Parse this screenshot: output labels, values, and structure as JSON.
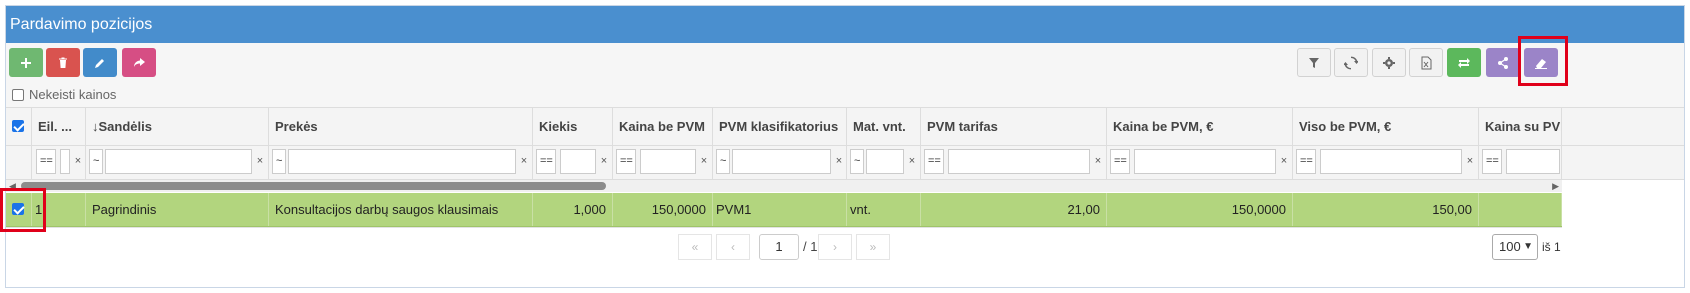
{
  "panel": {
    "title": "Pardavimo pozicijos"
  },
  "toolbar": {
    "left_buttons": [
      {
        "icon": "plus-icon",
        "color": "#6fb871"
      },
      {
        "icon": "trash-icon",
        "color": "#d9534f"
      },
      {
        "icon": "pencil-icon",
        "color": "#428bca"
      },
      {
        "icon": "share-arrow-icon",
        "color": "#d64e84"
      }
    ],
    "right_buttons": [
      {
        "icon": "filter-icon"
      },
      {
        "icon": "refresh-icon"
      },
      {
        "icon": "gear-icon"
      },
      {
        "icon": "excel-icon"
      },
      {
        "icon": "transfer-icon",
        "color": "#5cb85c"
      },
      {
        "icon": "share-nodes-icon",
        "color": "#9b84c8"
      },
      {
        "icon": "eraser-icon",
        "color": "#9b84c8"
      }
    ],
    "keep_prices_label": "Nekeisti kainos",
    "keep_prices_checked": false
  },
  "grid": {
    "columns": [
      {
        "key": "eil",
        "label": "Eil. ..."
      },
      {
        "key": "sandelis",
        "label": "↓Sandėlis"
      },
      {
        "key": "preke",
        "label": "Prekės"
      },
      {
        "key": "kiekis",
        "label": "Kiekis"
      },
      {
        "key": "kaina",
        "label": "Kaina be PVM"
      },
      {
        "key": "pvm_klas",
        "label": "PVM klasifikatorius"
      },
      {
        "key": "mat",
        "label": "Mat. vnt."
      },
      {
        "key": "pvm_tarifas",
        "label": "PVM tarifas"
      },
      {
        "key": "kaina_eur",
        "label": "Kaina be PVM, €"
      },
      {
        "key": "viso",
        "label": "Viso be PVM, €"
      },
      {
        "key": "kaina_su",
        "label": "Kaina su PVM"
      }
    ],
    "filters": {
      "eil": "==",
      "sandelis": "~",
      "preke": "~",
      "kiekis": "==",
      "kaina": "==",
      "pvm_klas": "~",
      "mat": "~",
      "pvm_tarifas": "==",
      "kaina_eur": "==",
      "viso": "==",
      "kaina_su": "==",
      "clear": "×"
    },
    "rows": [
      {
        "checked": true,
        "eil": "1",
        "sandelis": "Pagrindinis",
        "preke": "Konsultacijos darbų saugos klausimais",
        "kiekis": "1,000",
        "kaina": "150,0000",
        "pvm_klas": "PVM1",
        "mat": "vnt.",
        "pvm_tarifas": "21,00",
        "kaina_eur": "150,0000",
        "viso": "150,00",
        "kaina_su": ""
      }
    ]
  },
  "pager": {
    "first": "«",
    "prev": "‹",
    "next": "›",
    "last": "»",
    "current_page": "1",
    "total_pages": "/ 1",
    "per_page": "100",
    "of_label": "iš 1"
  },
  "colors": {
    "header": "#4a8fcf",
    "selected_row": "#b2d57e",
    "highlight": "#e0001a"
  }
}
